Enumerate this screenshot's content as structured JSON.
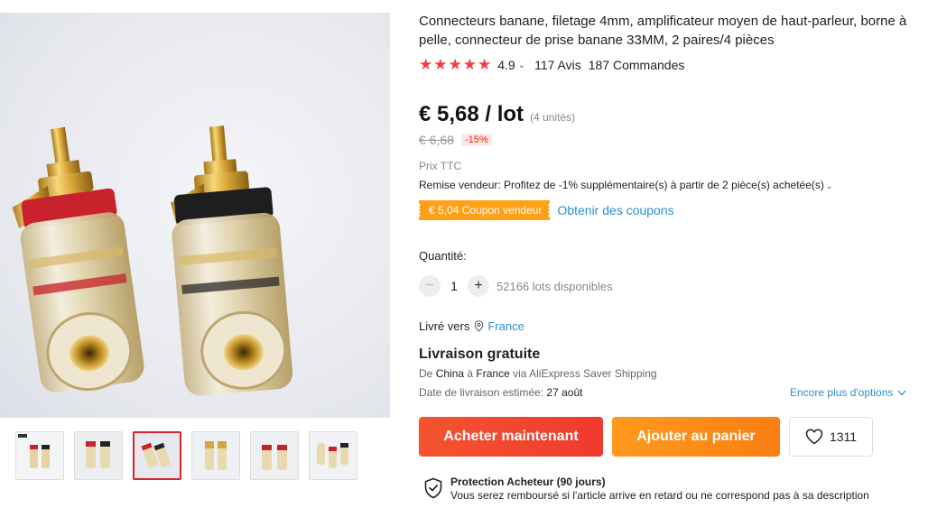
{
  "product": {
    "title": "Connecteurs banane, filetage 4mm, amplificateur moyen de haut-parleur, borne à pelle, connecteur de prise banane 33MM, 2 paires/4 pièces",
    "rating": "4.9",
    "rating_caret": "⌄",
    "reviews": "117 Avis",
    "orders": "187 Commandes",
    "stars": [
      "★",
      "★",
      "★",
      "★",
      "★"
    ]
  },
  "price": {
    "current": "€ 5,68 / lot",
    "units": "(4 unités)",
    "original": "€ 6,68",
    "discount": "-15%",
    "tax_note": "Prix TTC",
    "seller_discount": "Remise vendeur: Profitez de -1% supplémentaire(s) à partir de 2 pièce(s) achetée(s)",
    "seller_discount_caret": "⌄",
    "coupon": "€ 5,04 Coupon vendeur",
    "get_coupons": "Obtenir des coupons"
  },
  "quantity": {
    "label": "Quantité:",
    "minus": "−",
    "value": "1",
    "plus": "+",
    "stock": "52166 lots disponibles"
  },
  "shipping": {
    "label": "Livré vers",
    "country": "France",
    "free_title": "Livraison gratuite",
    "route_prefix": "De",
    "route_from": "China",
    "route_mid": "à",
    "route_to": "France",
    "route_suffix": "via AliExpress Saver Shipping",
    "delivery_label": "Date de livraison estimée:",
    "delivery_date": "27 août",
    "more_options": "Encore plus d'options"
  },
  "actions": {
    "buy_now": "Acheter maintenant",
    "add_to_cart": "Ajouter au panier",
    "wishlist_count": "1311"
  },
  "protection": {
    "title": "Protection Acheteur (90 jours)",
    "text": "Vous serez remboursé si l'article arrive en retard ou ne correspond pas à sa description"
  },
  "gallery": {
    "thumbnail_count": 6,
    "active_index": 2
  },
  "colors": {
    "star": "#ec3f45",
    "buy_now": "#f04b2f",
    "add_cart": "#fb8c17",
    "coupon": "#ffa019",
    "link": "#2a8fd0",
    "active_thumb_border": "#d8232a"
  }
}
